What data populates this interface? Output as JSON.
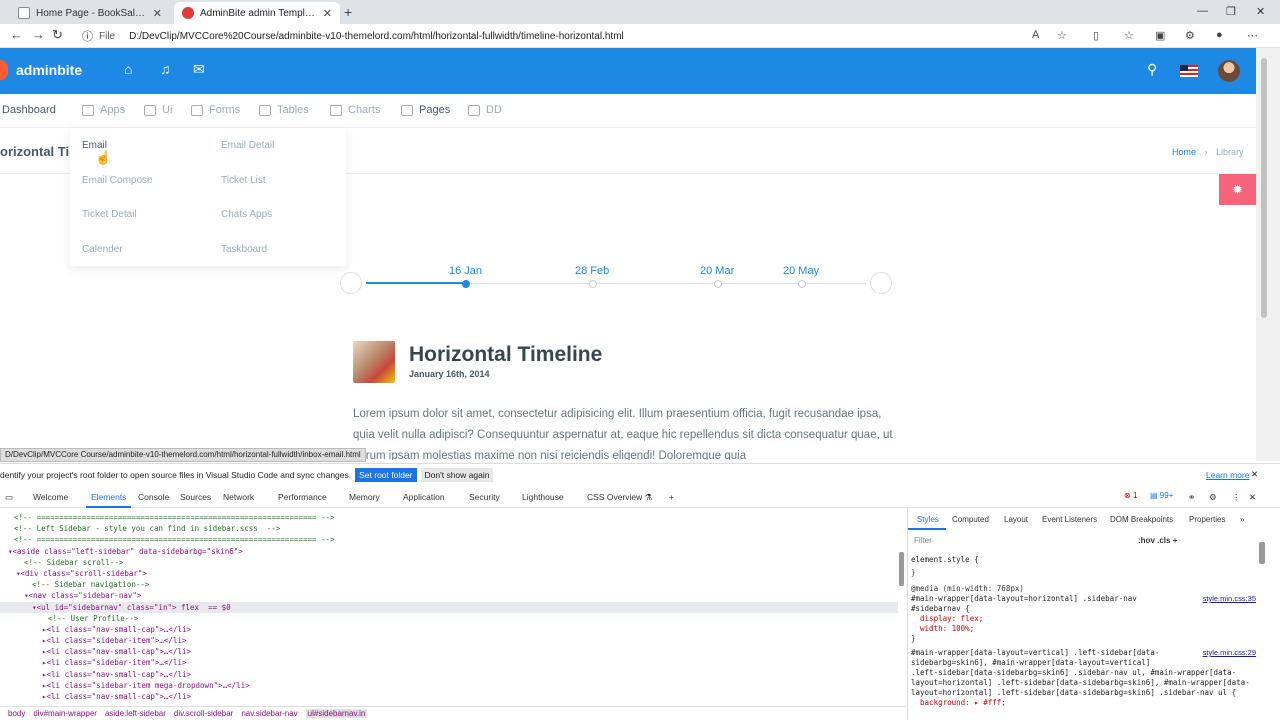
{
  "browser": {
    "tabs": [
      {
        "title": "Home Page - BookSale.Managem",
        "favicon_color": "#1565c0"
      },
      {
        "title": "AdminBite admin Template - The",
        "favicon_color": "#e53935"
      }
    ],
    "url_prefix": "File",
    "url": "D:/DevClip/MVCCore%20Course/adminbite-v10-themelord.com/html/horizontal-fullwidth/timeline-horizontal.html"
  },
  "app": {
    "brand": "adminbite",
    "menu": [
      "Dashboard",
      "Apps",
      "Ui",
      "Forms",
      "Tables",
      "Charts",
      "Pages",
      "DD"
    ],
    "page_title": "orizontal Tim",
    "breadcrumb": {
      "home": "Home",
      "current": "Library"
    },
    "dropdown": [
      "Email",
      "Email Detail",
      "Email Compose",
      "Ticket List",
      "Ticket Detail",
      "Chats Apps",
      "Calender",
      "Taskboard"
    ],
    "timeline": {
      "dates": [
        "16 Jan",
        "28 Feb",
        "20 Mar",
        "20 May"
      ],
      "active_index": 0,
      "title": "Horizontal Timeline",
      "date": "January 16th, 2014",
      "body": "Lorem ipsum dolor sit amet, consectetur adipisicing elit. Illum praesentium officia, fugit recusandae ipsa, quia velit nulla adipisci? Consequuntur aspernatur at, eaque hic repellendus sit dicta consequatur quae, ut harum ipsam molestias maxime non nisi reiciendis eligendi! Doloremque quia"
    },
    "accent": "#1e88e5"
  },
  "status_url": "D/DevClip/MVCCore Course/adminbite-v10-themelord.com/html/horizontal-fullwidth/inbox-email.html",
  "banner": {
    "text": "dentify your project's root folder to open source files in Visual Studio Code and sync changes.",
    "set_root": "Set root folder",
    "dont_show": "Don't show again",
    "learn_more": "Learn more"
  },
  "devtools": {
    "tabs": [
      "Welcome",
      "Elements",
      "Console",
      "Sources",
      "Network",
      "Performance",
      "Memory",
      "Application",
      "Security",
      "Lighthouse",
      "CSS Overview ⚗"
    ],
    "errors": "1",
    "messages": "99+",
    "code": [
      "<!-- ============================================================== -->",
      "<!-- Left Sidebar - style you can find in sidebar.scss  -->",
      "<!-- ============================================================== -->",
      "▾<aside class=\"left-sidebar\" data-sidebarbg=\"skin6\">",
      "<!-- Sidebar scroll-->",
      "▾<div class=\"scroll-sidebar\">",
      "<!-- Sidebar navigation-->",
      "▾<nav class=\"sidebar-nav\">",
      "▾<ul id=\"sidebarnav\" class=\"in\"> flex  == $0",
      "<!-- User Profile-->",
      "▸<li class=\"nav-small-cap\">…</li>",
      "▸<li class=\"sidebar-item\">…</li>",
      "▸<li class=\"nav-small-cap\">…</li>",
      "▸<li class=\"sidebar-item\">…</li>",
      "▸<li class=\"nav-small-cap\">…</li>",
      "▸<li class=\"sidebar-item mega-dropdown\">…</li>",
      "▸<li class=\"nav-small-cap\">…</li>"
    ],
    "crumbs": [
      "body",
      "div#main-wrapper",
      "aside.left-sidebar",
      "div.scroll-sidebar",
      "nav.sidebar-nav",
      "ul#sidebarnav.in"
    ],
    "styles_tabs": [
      "Styles",
      "Computed",
      "Layout",
      "Event Listeners",
      "DOM Breakpoints",
      "Properties"
    ],
    "filter_placeholder": "Filter",
    "filter_buttons": ":hov  .cls  +",
    "rules": [
      "element.style {",
      "}",
      "@media (min-width: 768px)",
      "#main-wrapper[data-layout=horizontal] .sidebar-nav",
      "#sidebarnav {",
      "  display: flex;",
      "  width: 100%;",
      "}",
      "#main-wrapper[data-layout=vertical] .left-sidebar[data-",
      "sidebarbg=skin6], #main-wrapper[data-layout=vertical]",
      ".left-sidebar[data-sidebarbg=skin6] .sidebar-nav ul, #main-wrapper[data-",
      "layout=horizontal] .left-sidebar[data-sidebarbg=skin6], #main-wrapper[data-",
      "layout=horizontal] .left-sidebar[data-sidebarbg=skin6] .sidebar-nav ul {",
      "  background: ▸ #fff;"
    ],
    "links": [
      "style.min.css:35",
      "style.min.css:29"
    ]
  }
}
